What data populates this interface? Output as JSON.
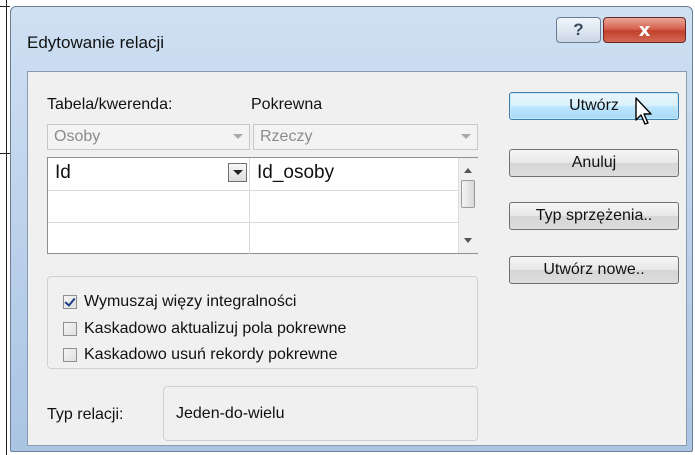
{
  "window": {
    "title": "Edytowanie relacji"
  },
  "titlebar": {
    "help_glyph": "?",
    "close_glyph": "x"
  },
  "relation": {
    "table_label": "Tabela/kwerenda:",
    "related_label": "Pokrewna",
    "table_value": "Osoby",
    "related_value": "Rzeczy",
    "fields": [
      {
        "left": "Id",
        "right": "Id_osoby"
      },
      {
        "left": "",
        "right": ""
      },
      {
        "left": "",
        "right": ""
      }
    ]
  },
  "options": {
    "enforce_integrity": {
      "label": "Wymuszaj więzy integralności",
      "checked": true
    },
    "cascade_update": {
      "label": "Kaskadowo aktualizuj pola pokrewne",
      "checked": false
    },
    "cascade_delete": {
      "label": "Kaskadowo usuń rekordy pokrewne",
      "checked": false
    }
  },
  "relation_type": {
    "label": "Typ relacji:",
    "value": "Jeden-do-wielu"
  },
  "buttons": {
    "create": "Utwórz",
    "cancel": "Anuluj",
    "join_type": "Typ sprzężenia..",
    "create_new": "Utwórz nowe.."
  },
  "icons": {
    "help": "help-icon",
    "close": "close-icon",
    "dropdown": "chevron-down-icon",
    "checkbox": "checkmark-icon",
    "cursor": "mouse-pointer-icon"
  }
}
